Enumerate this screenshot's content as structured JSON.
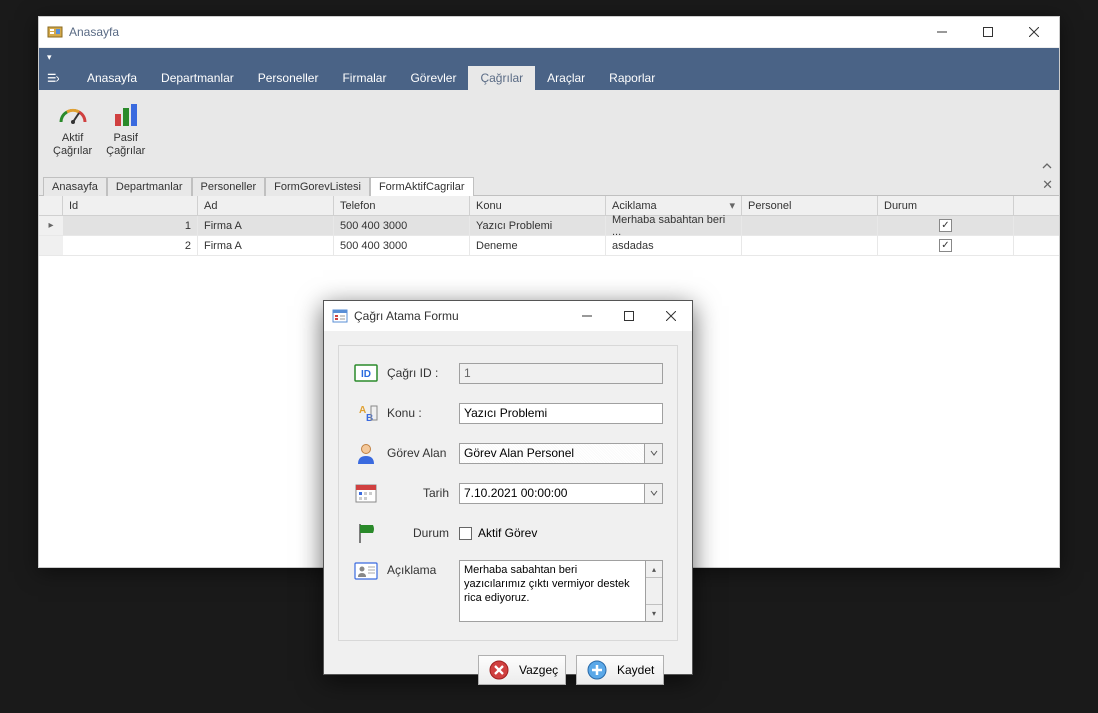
{
  "window": {
    "title": "Anasayfa"
  },
  "ribbon": {
    "tabs": [
      "Anasayfa",
      "Departmanlar",
      "Personeller",
      "Firmalar",
      "Görevler",
      "Çağrılar",
      "Araçlar",
      "Raporlar"
    ],
    "active_tab": "Çağrılar",
    "buttons": [
      {
        "label": "Aktif\nÇağrılar"
      },
      {
        "label": "Pasif\nÇağrılar"
      }
    ]
  },
  "doc_tabs": {
    "items": [
      "Anasayfa",
      "Departmanlar",
      "Personeller",
      "FormGorevListesi",
      "FormAktifCagrilar"
    ],
    "active": "FormAktifCagrilar"
  },
  "grid": {
    "headers": {
      "id": "Id",
      "ad": "Ad",
      "telefon": "Telefon",
      "konu": "Konu",
      "aciklama": "Aciklama",
      "personel": "Personel",
      "durum": "Durum"
    },
    "rows": [
      {
        "id": "1",
        "ad": "Firma A",
        "telefon": "500 400 3000",
        "konu": "Yazıcı Problemi",
        "aciklama": "Merhaba sabahtan beri ...",
        "personel": "",
        "durum": true
      },
      {
        "id": "2",
        "ad": "Firma A",
        "telefon": "500 400 3000",
        "konu": "Deneme",
        "aciklama": "asdadas",
        "personel": "",
        "durum": true
      }
    ]
  },
  "dialog": {
    "title": "Çağrı Atama Formu",
    "labels": {
      "cagri_id": "Çağrı ID :",
      "konu": "Konu :",
      "gorev_alan": "Görev Alan",
      "tarih": "Tarih",
      "durum": "Durum",
      "aciklama": "Açıklama"
    },
    "values": {
      "cagri_id": "1",
      "konu": "Yazıcı Problemi",
      "gorev_alan": "Görev Alan Personel",
      "tarih": "7.10.2021 00:00:00",
      "durum_checkbox_label": "Aktif Görev",
      "aciklama": "Merhaba sabahtan beri yazıcılarımız çıktı vermiyor destek rica ediyoruz."
    },
    "buttons": {
      "vazgec": "Vazgeç",
      "kaydet": "Kaydet"
    }
  }
}
